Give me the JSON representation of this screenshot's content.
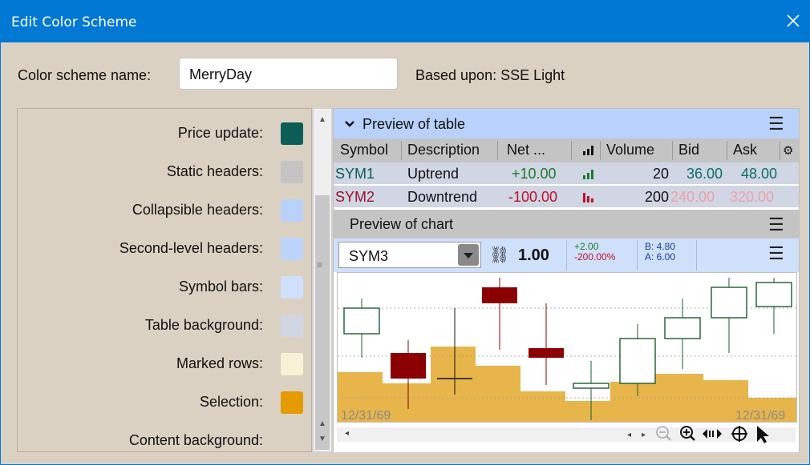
{
  "window": {
    "title": "Edit Color Scheme"
  },
  "form": {
    "name_label": "Color scheme name:",
    "name_value": "MerryDay",
    "based_upon": "Based upon: SSE Light"
  },
  "color_rows": [
    {
      "label": "Price update:",
      "color": "#0b5e55"
    },
    {
      "label": "Static headers:",
      "color": "#c4c4c4"
    },
    {
      "label": "Collapsible headers:",
      "color": "#b8d2fb"
    },
    {
      "label": "Second-level headers:",
      "color": "#bcd4fb"
    },
    {
      "label": "Symbol bars:",
      "color": "#cfe0fb"
    },
    {
      "label": "Table background:",
      "color": "#d0d6e3"
    },
    {
      "label": "Marked rows:",
      "color": "#f9f1d4"
    },
    {
      "label": "Selection:",
      "color": "#e59a00"
    },
    {
      "label": "Content background:",
      "color": ""
    }
  ],
  "preview": {
    "table_title": "Preview of table",
    "columns": [
      "Symbol",
      "Description",
      "Net ...",
      "",
      "Volume",
      "Bid",
      "Ask"
    ],
    "rows": [
      {
        "symbol": "SYM1",
        "description": "Uptrend",
        "net": "+10.00",
        "volume": "20",
        "bid": "36.00",
        "ask": "48.00",
        "trend": "up"
      },
      {
        "symbol": "SYM2",
        "description": "Downtrend",
        "net": "-100.00",
        "volume": "200",
        "bid": "240.00",
        "ask": "320.00",
        "trend": "down"
      }
    ],
    "chart_title": "Preview of chart",
    "symbol": "SYM3",
    "last": "1.00",
    "change": "+2.00",
    "change_pct": "-200.00%",
    "bid": "B: 4.80",
    "ask": "A: 6.00",
    "date_left": "12/31/69",
    "date_right": "12/31/69"
  },
  "colors": {
    "title_bar": "#0078d4",
    "up": "#1a5e2c",
    "down": "#a00000",
    "volume": "#e8b54a"
  }
}
